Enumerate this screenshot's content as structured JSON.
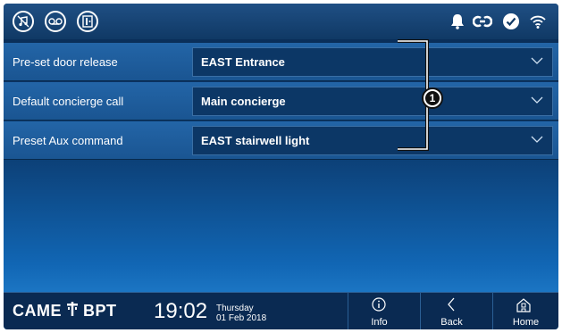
{
  "status_icons": [
    "music-off-icon",
    "voicemail-icon",
    "door-icon",
    "bell-icon",
    "link-icon",
    "check-circle-icon",
    "wifi-icon"
  ],
  "rows": [
    {
      "label": "Pre-set door release",
      "value": "EAST Entrance"
    },
    {
      "label": "Default concierge call",
      "value": "Main concierge"
    },
    {
      "label": "Preset Aux command",
      "value": "EAST stairwell light"
    }
  ],
  "callout": {
    "number": "1"
  },
  "footer": {
    "logo_left": "CAME",
    "logo_right": "BPT",
    "time": "19:02",
    "day": "Thursday",
    "date": "01 Feb 2018",
    "buttons": [
      {
        "label": "Info"
      },
      {
        "label": "Back"
      },
      {
        "label": "Home"
      }
    ]
  },
  "colors": {
    "accent": "#1a5592",
    "status_bar": "#103965",
    "select_bg": "#0c3766"
  }
}
